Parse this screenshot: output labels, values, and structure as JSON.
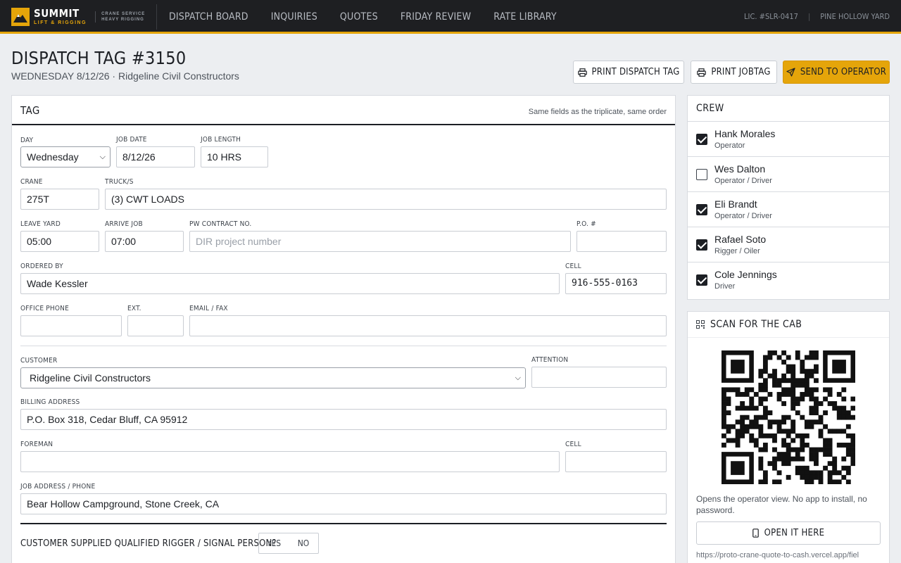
{
  "brand": {
    "name": "SUMMIT",
    "sub": "LIFT & RIGGING",
    "tag_line1": "CRANE SERVICE",
    "tag_line2": "HEAVY RIGGING",
    "accent": "#e5a50a"
  },
  "nav": [
    "DISPATCH BOARD",
    "INQUIRIES",
    "QUOTES",
    "FRIDAY REVIEW",
    "RATE LIBRARY"
  ],
  "topright": {
    "license": "LIC. #SLR-0417",
    "yard": "PINE HOLLOW YARD"
  },
  "header": {
    "title": "DISPATCH TAG #3150",
    "subtitle": "WEDNESDAY 8/12/26 · Ridgeline Civil Constructors"
  },
  "actions": {
    "print_dispatch": "PRINT DISPATCH TAG",
    "print_jobtag": "PRINT JOBTAG",
    "send": "SEND TO OPERATOR"
  },
  "tag": {
    "title": "TAG",
    "note": "Same fields as the triplicate, same order",
    "day_label": "DAY",
    "day_value": "Wednesday",
    "job_date_label": "JOB DATE",
    "job_date": "8/12/26",
    "job_length_label": "JOB LENGTH",
    "job_length": "10 HRS",
    "crane_label": "CRANE",
    "crane": "275T",
    "trucks_label": "TRUCK/S",
    "trucks": "(3) CWT LOADS",
    "leave_yard_label": "LEAVE YARD",
    "leave_yard": "05:00",
    "arrive_job_label": "ARRIVE JOB",
    "arrive_job": "07:00",
    "pw_label": "PW CONTRACT NO.",
    "pw_placeholder": "DIR project number",
    "po_label": "P.O. #",
    "po": "",
    "ordered_by_label": "ORDERED BY",
    "ordered_by": "Wade Kessler",
    "cell_label": "CELL",
    "cell": "916-555-0163",
    "office_phone_label": "OFFICE PHONE",
    "office_phone": "",
    "ext_label": "EXT.",
    "ext": "",
    "email_label": "EMAIL / FAX",
    "email": "",
    "customer_label": "CUSTOMER",
    "customer": "Ridgeline Civil Constructors",
    "attention_label": "ATTENTION",
    "attention": "",
    "billing_label": "BILLING ADDRESS",
    "billing": "P.O. Box 318, Cedar Bluff, CA 95912",
    "foreman_label": "FOREMAN",
    "foreman": "",
    "foreman_cell_label": "CELL",
    "foreman_cell": "",
    "job_address_label": "JOB ADDRESS / PHONE",
    "job_address": "Bear Hollow Campground, Stone Creek, CA",
    "rigger_question": "CUSTOMER SUPPLIED QUALIFIED RIGGER / SIGNAL PERSON?",
    "yes": "YES",
    "no": "NO"
  },
  "crew": {
    "title": "CREW",
    "members": [
      {
        "name": "Hank Morales",
        "role": "Operator",
        "checked": true
      },
      {
        "name": "Wes Dalton",
        "role": "Operator / Driver",
        "checked": false
      },
      {
        "name": "Eli Brandt",
        "role": "Operator / Driver",
        "checked": true
      },
      {
        "name": "Rafael Soto",
        "role": "Rigger / Oiler",
        "checked": true
      },
      {
        "name": "Cole Jennings",
        "role": "Driver",
        "checked": true
      }
    ]
  },
  "scan": {
    "title": "SCAN FOR THE CAB",
    "text": "Opens the operator view. No app to install, no password.",
    "open_button": "OPEN IT HERE",
    "url": "https://proto-crane-quote-to-cash.vercel.app/fiel"
  }
}
